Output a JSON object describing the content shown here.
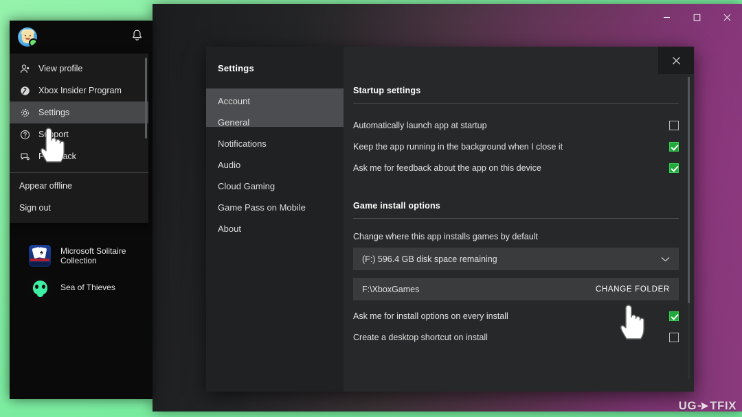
{
  "window": {
    "controls": {
      "minimize": "minimize-button",
      "maximize": "maximize-button",
      "close": "close-button"
    }
  },
  "profile_flyout": {
    "avatar": "xbox-avatar",
    "notifications_icon": "bell-icon",
    "menu_items": [
      {
        "label": "View profile",
        "icon": "person-icon",
        "active": false
      },
      {
        "label": "Xbox Insider Program",
        "icon": "xbox-insider-icon",
        "active": false
      },
      {
        "label": "Settings",
        "icon": "gear-icon",
        "active": true
      },
      {
        "label": "Support",
        "icon": "question-circle-icon",
        "active": false
      },
      {
        "label": "Feedback",
        "icon": "feedback-icon",
        "active": false
      }
    ],
    "plain_items": [
      {
        "label": "Appear offline"
      },
      {
        "label": "Sign out"
      }
    ],
    "games": [
      {
        "name": "Microsoft Solitaire Collection",
        "icon": "solitaire-tile-icon"
      },
      {
        "name": "Sea of Thieves",
        "icon": "sea-of-thieves-tile-icon"
      }
    ]
  },
  "settings_dialog": {
    "title": "Settings",
    "close_label": "✕",
    "nav_items": [
      {
        "label": "Account",
        "selected": true
      },
      {
        "label": "General",
        "selected": true
      },
      {
        "label": "Notifications",
        "selected": false
      },
      {
        "label": "Audio",
        "selected": false
      },
      {
        "label": "Cloud Gaming",
        "selected": false
      },
      {
        "label": "Game Pass on Mobile",
        "selected": false
      },
      {
        "label": "About",
        "selected": false
      }
    ],
    "startup_section": {
      "heading": "Startup settings",
      "options": [
        {
          "label": "Automatically launch app at startup",
          "checked": false
        },
        {
          "label": "Keep the app running in the background when I close it",
          "checked": true
        },
        {
          "label": "Ask me for feedback about the app on this device",
          "checked": true
        }
      ]
    },
    "install_section": {
      "heading": "Game install options",
      "field_label": "Change where this app installs games by default",
      "drive_select_value": "(F:) 596.4 GB disk space remaining",
      "install_path": "F:\\XboxGames",
      "change_folder_label": "CHANGE FOLDER",
      "options": [
        {
          "label": "Ask me for install options on every install",
          "checked": true
        },
        {
          "label": "Create a desktop shortcut on install",
          "checked": false
        }
      ]
    }
  },
  "colors": {
    "backdrop_green": "#8df0a6",
    "checkbox_on": "#22a93c",
    "dialog_bg": "#272829",
    "nav_highlight": "#4b4d50"
  },
  "watermark": {
    "text_left": "UG",
    "text_right": "TFIX"
  }
}
